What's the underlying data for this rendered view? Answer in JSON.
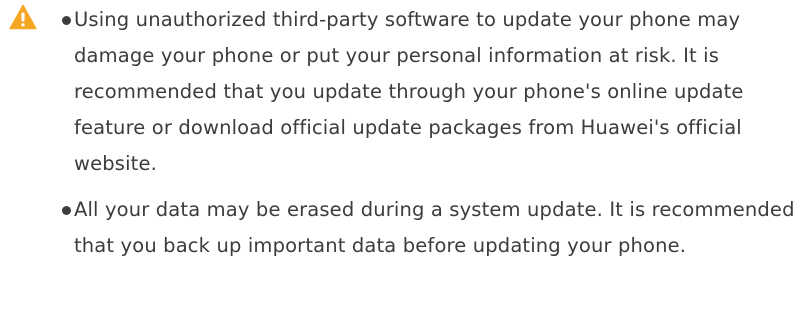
{
  "notice": {
    "icon": "warning-triangle-icon",
    "icon_color": "#f5a623",
    "items": [
      {
        "text": "Using unauthorized third-party software to update your phone may damage your phone or put your personal information at risk. It is recommended that you update through your phone's online update feature or download official update packages from Huawei's official website."
      },
      {
        "text": "All your data may be erased during a system update. It is recommended that you back up important data before updating your phone."
      }
    ]
  }
}
